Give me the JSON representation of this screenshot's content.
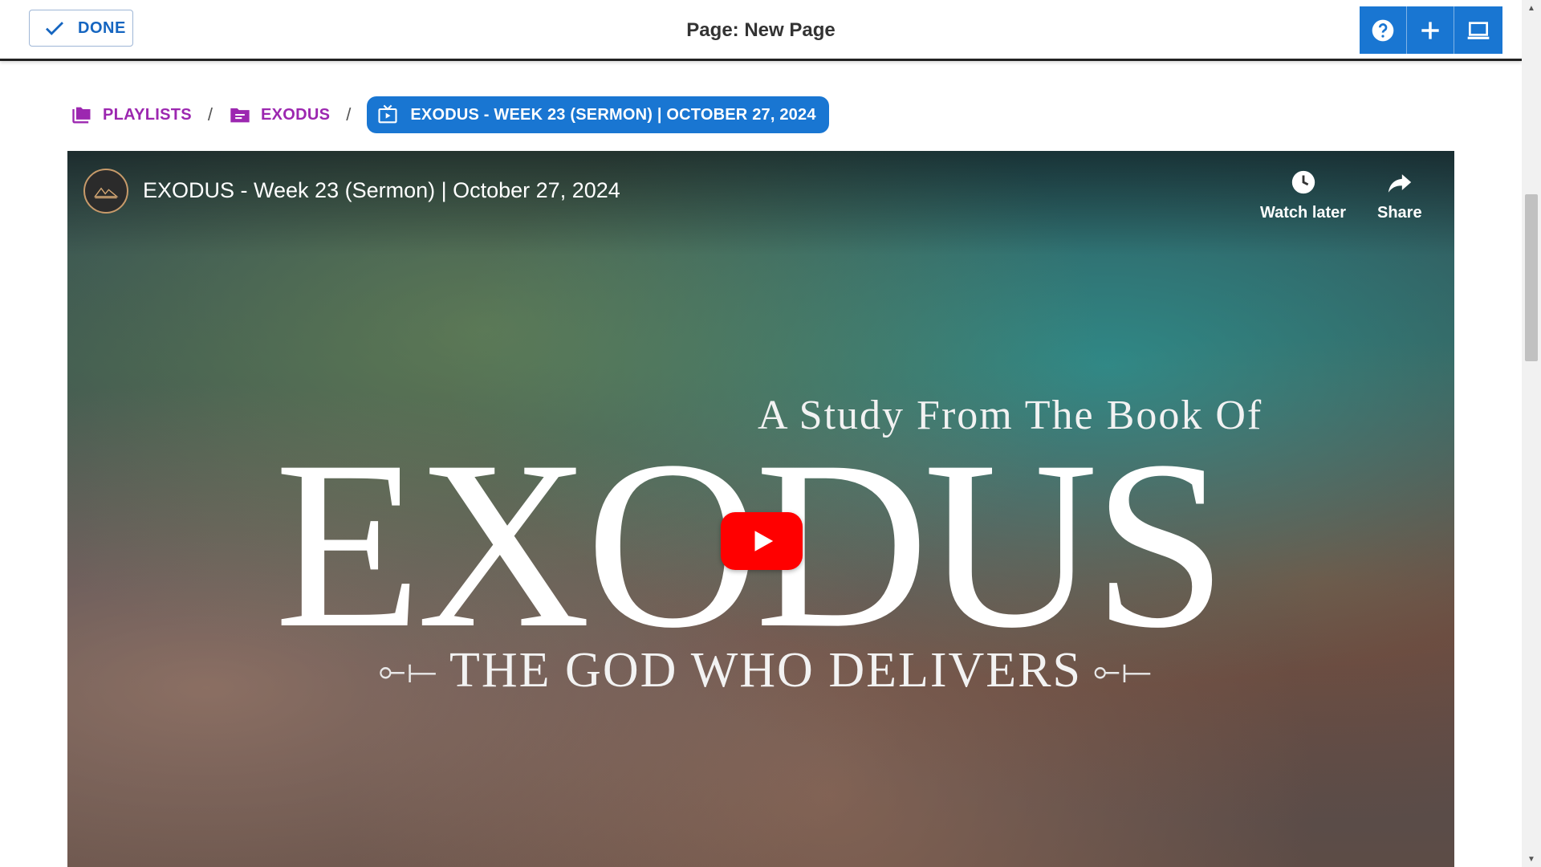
{
  "header": {
    "done_label": "DONE",
    "page_title": "Page: New Page"
  },
  "top_actions": [
    "help-icon",
    "add-icon",
    "device-preview-icon"
  ],
  "breadcrumb": {
    "items": [
      {
        "label": "PLAYLISTS",
        "icon": "playlists-folder-icon"
      },
      {
        "label": "EXODUS",
        "icon": "folder-list-icon"
      }
    ],
    "separator": "/",
    "current": {
      "label": "EXODUS - WEEK 23 (SERMON) | OCTOBER 27, 2024",
      "icon": "video-tv-icon"
    }
  },
  "video": {
    "title": "EXODUS - Week 23 (Sermon) | October 27, 2024",
    "watch_later_label": "Watch later",
    "share_label": "Share",
    "thumbnail": {
      "tagline": "A Study From The Book Of",
      "headline": "EXODUS",
      "subtitle": "THE GOD WHO DELIVERS",
      "flourish_left": "⟜⟝",
      "flourish_right": "⟜⟝"
    }
  },
  "colors": {
    "primary": "#1976d2",
    "crumb": "#9c27b0",
    "play": "#ff0000"
  }
}
